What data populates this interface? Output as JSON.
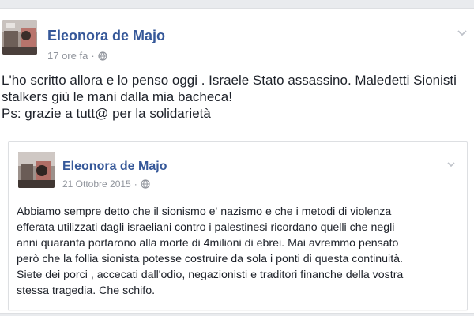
{
  "post": {
    "author": "Eleonora de Majo",
    "timestamp": "17 ore fa",
    "separator": "·",
    "lines": [
      "L'ho scritto allora e lo penso oggi . Israele Stato assassino. Maledetti Sionisti",
      "stalkers giù le mani dalla mia bacheca!",
      "Ps: grazie a tutt@ per la solidarietà"
    ]
  },
  "shared_post": {
    "author": "Eleonora de Majo",
    "timestamp": "21 Ottobre 2015",
    "separator": "·",
    "lines": [
      "Abbiamo sempre detto che il sionismo e' nazismo e che i metodi di violenza",
      "efferata utilizzati dagli israeliani contro i palestinesi ricordano quelli che negli",
      "anni quaranta portarono alla morte di 4milioni di ebrei. Mai avremmo pensato",
      "però che la follia sionista potesse costruire da sola i ponti di questa continuità.",
      "Siete dei porci , accecati dall'odio, negazionisti e traditori finanche della vostra",
      "stessa tragedia. Che schifo."
    ]
  },
  "icons": {
    "globe": "globe-icon",
    "menu": "chevron-down-icon"
  },
  "colors": {
    "author_link": "#365899",
    "meta_text": "#90949c",
    "body_text": "#1d2129"
  }
}
